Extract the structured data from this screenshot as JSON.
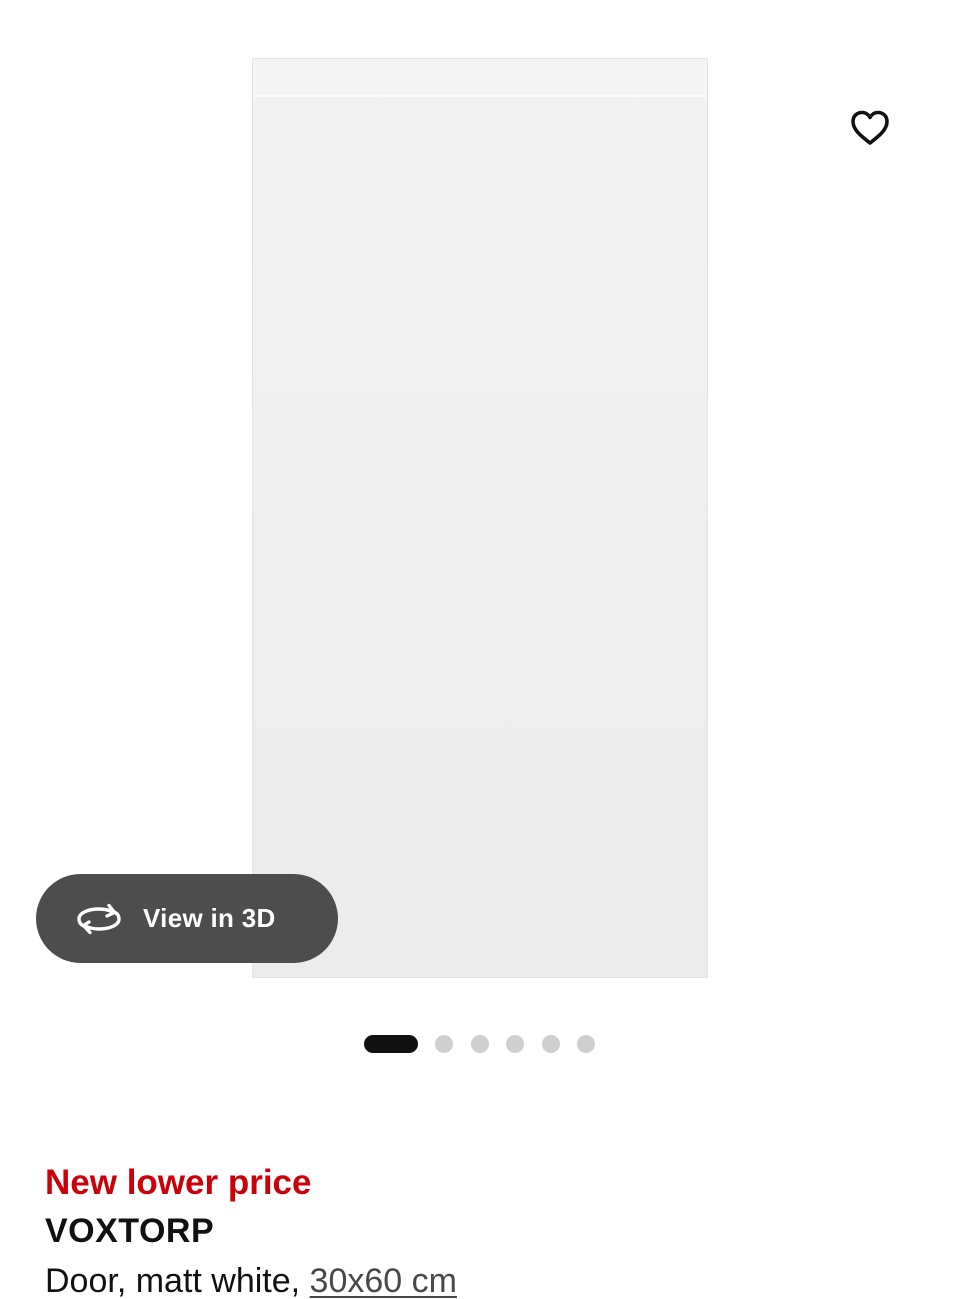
{
  "gallery": {
    "view3d_label": "View in 3D",
    "favourite_icon": "heart-outline-icon",
    "rotate_icon": "rotate-3d-icon",
    "image_count": 6,
    "active_image": 1
  },
  "product": {
    "badge": "New lower price",
    "name": "VOXTORP",
    "description": "Door, matt white, ",
    "size": "30x60 cm"
  },
  "colors": {
    "badge_red": "#cc0008",
    "text": "#111111",
    "view3d_bg": "#4d4d4d",
    "dot_active": "#111111",
    "dot_inactive": "#cfcfcf"
  }
}
